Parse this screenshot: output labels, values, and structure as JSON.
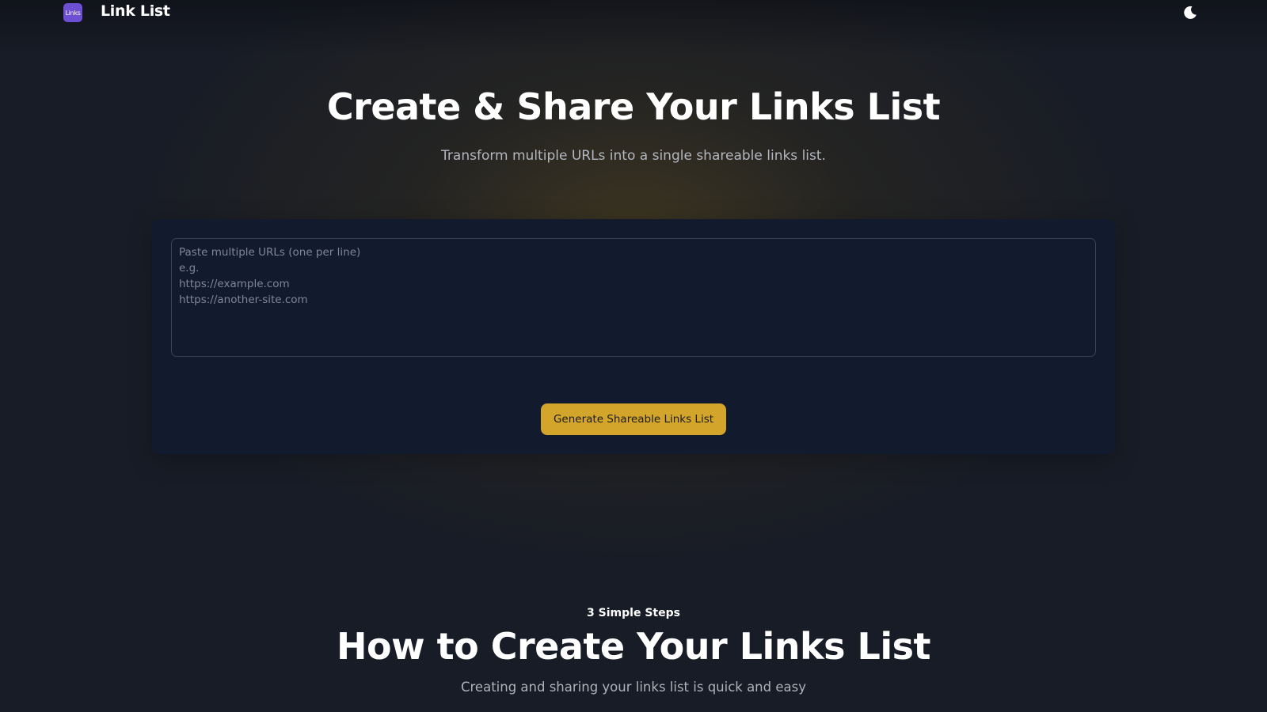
{
  "header": {
    "logo_text": "Links",
    "brand_name": "Link List",
    "theme_toggle_icon": "moon-icon"
  },
  "hero": {
    "title": "Create & Share Your Links List",
    "subtitle": "Transform multiple URLs into a single shareable links list."
  },
  "form": {
    "textarea_value": "",
    "textarea_placeholder": "Paste multiple URLs (one per line)\ne.g.\nhttps://example.com\nhttps://another-site.com",
    "generate_button_label": "Generate Shareable Links List"
  },
  "steps": {
    "kicker": "3 Simple Steps",
    "title": "How to Create Your Links List",
    "subtitle": "Creating and sharing your links list is quick and easy"
  },
  "colors": {
    "accent": "#d4a52b",
    "logo_badge": "#6d4fd3",
    "card_background": "#121a2e",
    "page_background": "#181c26"
  }
}
